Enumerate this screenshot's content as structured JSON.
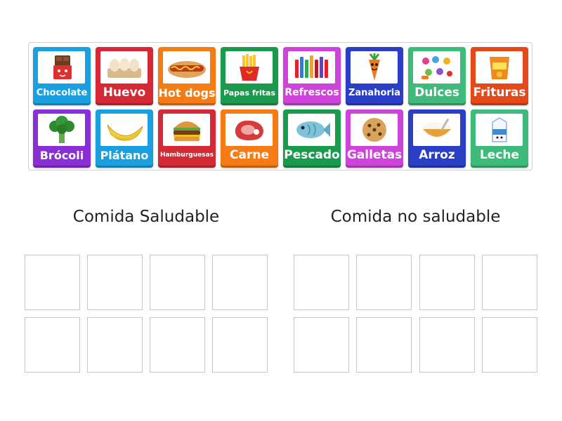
{
  "cards": [
    {
      "label": "Chocolate",
      "color": "c-blue",
      "size": 13,
      "icon": "chocolate-icon"
    },
    {
      "label": "Huevo",
      "color": "c-red",
      "size": 17,
      "icon": "egg-icon"
    },
    {
      "label": "Hot dogs",
      "color": "c-orange",
      "size": 16,
      "icon": "hotdog-icon"
    },
    {
      "label": "Papas fritas",
      "color": "c-green",
      "size": 11,
      "icon": "fries-icon"
    },
    {
      "label": "Refrescos",
      "color": "c-purple",
      "size": 14,
      "icon": "soda-icon"
    },
    {
      "label": "Zanahoria",
      "color": "c-navy",
      "size": 13,
      "icon": "carrot-icon"
    },
    {
      "label": "Dulces",
      "color": "c-mint",
      "size": 17,
      "icon": "candy-icon"
    },
    {
      "label": "Frituras",
      "color": "c-fire",
      "size": 17,
      "icon": "chips-icon"
    },
    {
      "label": "Brócoli",
      "color": "c-violet",
      "size": 16,
      "icon": "broccoli-icon"
    },
    {
      "label": "Plátano",
      "color": "c-blue",
      "size": 16,
      "icon": "banana-icon"
    },
    {
      "label": "Hamburguesas",
      "color": "c-red",
      "size": 9,
      "icon": "burger-icon"
    },
    {
      "label": "Carne",
      "color": "c-orange",
      "size": 17,
      "icon": "meat-icon"
    },
    {
      "label": "Pescado",
      "color": "c-green",
      "size": 17,
      "icon": "fish-icon"
    },
    {
      "label": "Galletas",
      "color": "c-purple",
      "size": 17,
      "icon": "cookie-icon"
    },
    {
      "label": "Arroz",
      "color": "c-navy",
      "size": 17,
      "icon": "rice-icon"
    },
    {
      "label": "Leche",
      "color": "c-mint",
      "size": 17,
      "icon": "milk-icon"
    }
  ],
  "groups": {
    "healthy": {
      "title": "Comida Saludable"
    },
    "unhealthy": {
      "title": "Comida no saludable"
    }
  }
}
